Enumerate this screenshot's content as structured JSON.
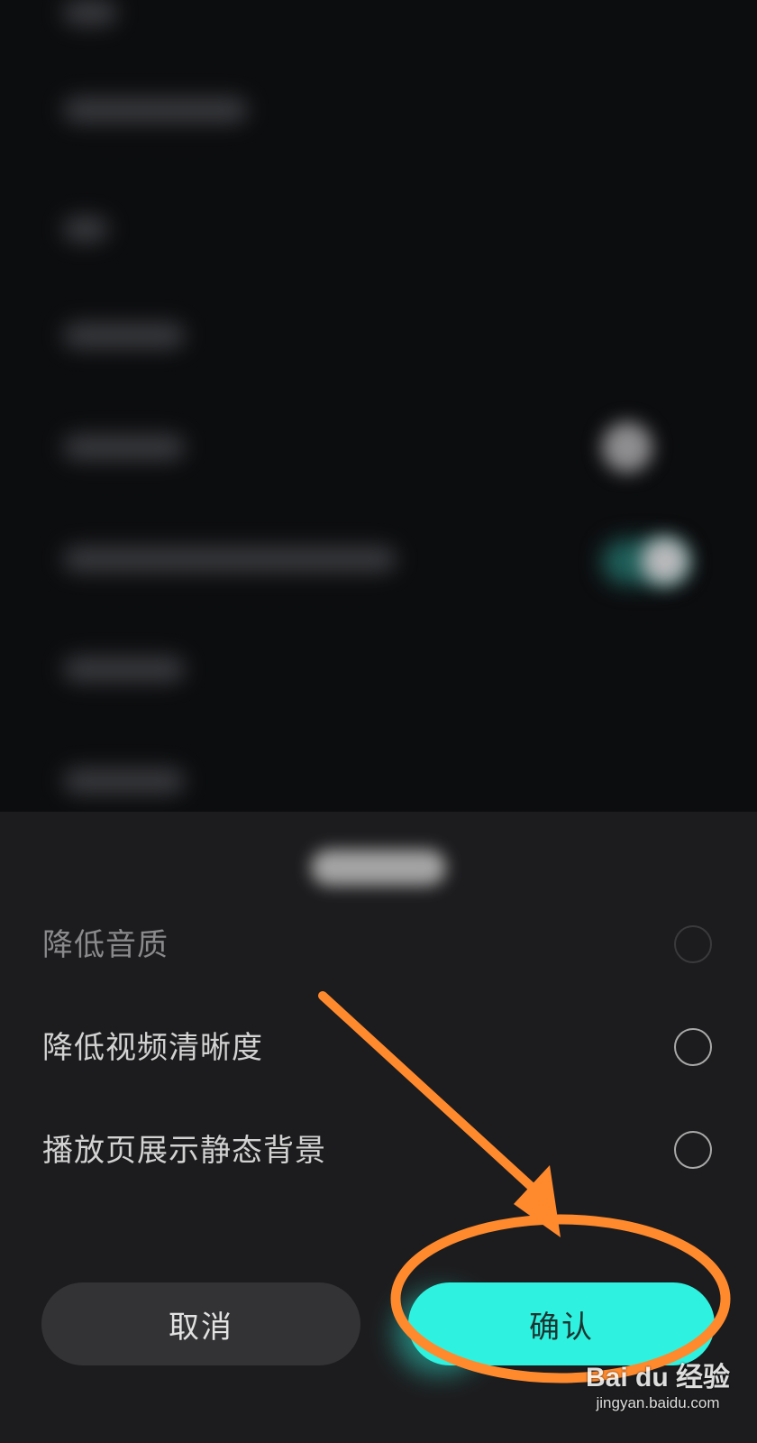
{
  "sheet": {
    "options": [
      {
        "label": "降低音质",
        "selected": false,
        "faded": true
      },
      {
        "label": "降低视频清晰度",
        "selected": false,
        "faded": false
      },
      {
        "label": "播放页展示静态背景",
        "selected": false,
        "faded": false
      }
    ],
    "cancel_label": "取消",
    "confirm_label": "确认"
  },
  "colors": {
    "accent": "#2ef2df",
    "annotation": "#ff8a2e",
    "sheet_background": "#1c1c1e",
    "page_background": "#0c0d0f"
  },
  "watermark": {
    "brand": "Bai du 经验",
    "url": "jingyan.baidu.com"
  }
}
